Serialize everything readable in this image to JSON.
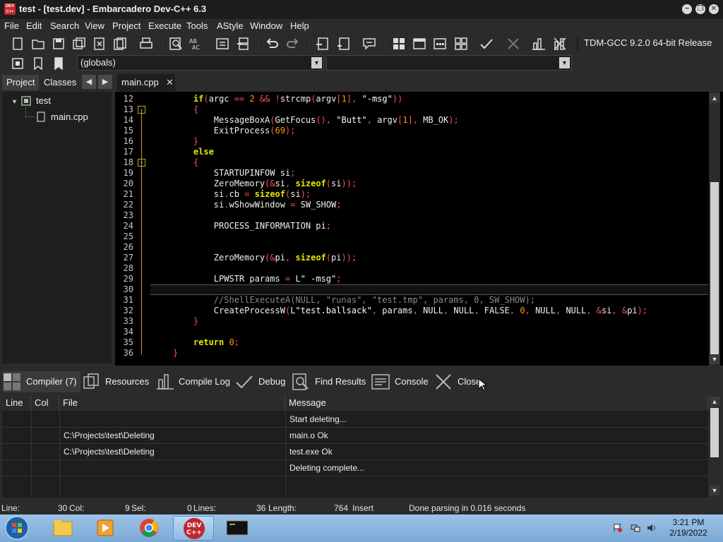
{
  "window": {
    "title": "test - [test.dev] - Embarcadero Dev-C++ 6.3",
    "app_icon_text": "DEV C++"
  },
  "menu": [
    "File",
    "Edit",
    "Search",
    "View",
    "Project",
    "Execute",
    "Tools",
    "AStyle",
    "Window",
    "Help"
  ],
  "toolbar": {
    "compiler": "TDM-GCC 9.2.0 64-bit Release",
    "scope_dropdown": "(globals)",
    "scope2_dropdown": ""
  },
  "left_panel": {
    "tabs": [
      "Project",
      "Classes"
    ],
    "tree": {
      "project": "test",
      "file": "main.cpp"
    }
  },
  "editor": {
    "tab": "main.cpp",
    "lines": [
      {
        "n": "12",
        "fold": ""
      },
      {
        "n": "13",
        "fold": "−"
      },
      {
        "n": "14",
        "fold": ""
      },
      {
        "n": "15",
        "fold": ""
      },
      {
        "n": "16",
        "fold": ""
      },
      {
        "n": "17",
        "fold": ""
      },
      {
        "n": "18",
        "fold": "−"
      },
      {
        "n": "19",
        "fold": ""
      },
      {
        "n": "20",
        "fold": ""
      },
      {
        "n": "21",
        "fold": ""
      },
      {
        "n": "22",
        "fold": ""
      },
      {
        "n": "23",
        "fold": ""
      },
      {
        "n": "24",
        "fold": ""
      },
      {
        "n": "25",
        "fold": ""
      },
      {
        "n": "26",
        "fold": ""
      },
      {
        "n": "27",
        "fold": ""
      },
      {
        "n": "28",
        "fold": ""
      },
      {
        "n": "29",
        "fold": ""
      },
      {
        "n": "30",
        "fold": ""
      },
      {
        "n": "31",
        "fold": ""
      },
      {
        "n": "32",
        "fold": ""
      },
      {
        "n": "33",
        "fold": ""
      },
      {
        "n": "34",
        "fold": ""
      },
      {
        "n": "35",
        "fold": ""
      },
      {
        "n": "36",
        "fold": ""
      }
    ],
    "code": [
      "    if(argc == 2 && !strcmp(argv[1], \"-msg\"))",
      "    {",
      "        MessageBoxA(GetFocus(), \"Butt\", argv[1], MB_OK);",
      "        ExitProcess(69);",
      "    }",
      "    else",
      "    {",
      "        STARTUPINFOW si;",
      "        ZeroMemory(&si, sizeof(si));",
      "        si.cb = sizeof(si);",
      "        si.wShowWindow = SW_SHOW;",
      "",
      "        PROCESS_INFORMATION pi;",
      "",
      "",
      "        ZeroMemory(&pi, sizeof(pi));",
      "",
      "        LPWSTR params = L\" -msg\";",
      "",
      "        //ShellExecuteA(NULL, \"runas\", \"test.tmp\", params, 0, SW_SHOW);",
      "        CreateProcessW(L\"test.ballsack\", params, NULL, NULL, FALSE, 0, NULL, NULL, &si, &pi);",
      "    }",
      "",
      "    return 0;",
      "}"
    ]
  },
  "bottom_tabs": [
    "Compiler (7)",
    "Resources",
    "Compile Log",
    "Debug",
    "Find Results",
    "Console",
    "Close"
  ],
  "messages": {
    "headers": [
      "Line",
      "Col",
      "File",
      "Message"
    ],
    "rows": [
      {
        "line": "",
        "col": "",
        "file": "",
        "message": "Start deleting..."
      },
      {
        "line": "",
        "col": "",
        "file": "C:\\Projects\\test\\Deleting",
        "message": "main.o Ok"
      },
      {
        "line": "",
        "col": "",
        "file": "C:\\Projects\\test\\Deleting",
        "message": "test.exe Ok"
      },
      {
        "line": "",
        "col": "",
        "file": "",
        "message": "Deleting complete..."
      }
    ]
  },
  "status": {
    "line_label": "Line:",
    "line": "30",
    "col_label": "Col:",
    "col": "9",
    "sel_label": "Sel:",
    "sel": "0",
    "lines_label": "Lines:",
    "lines": "36",
    "length_label": "Length:",
    "length": "764",
    "mode": "Insert",
    "message": "Done parsing in 0.016 seconds"
  },
  "taskbar": {
    "time": "3:21 PM",
    "date": "2/19/2022"
  }
}
